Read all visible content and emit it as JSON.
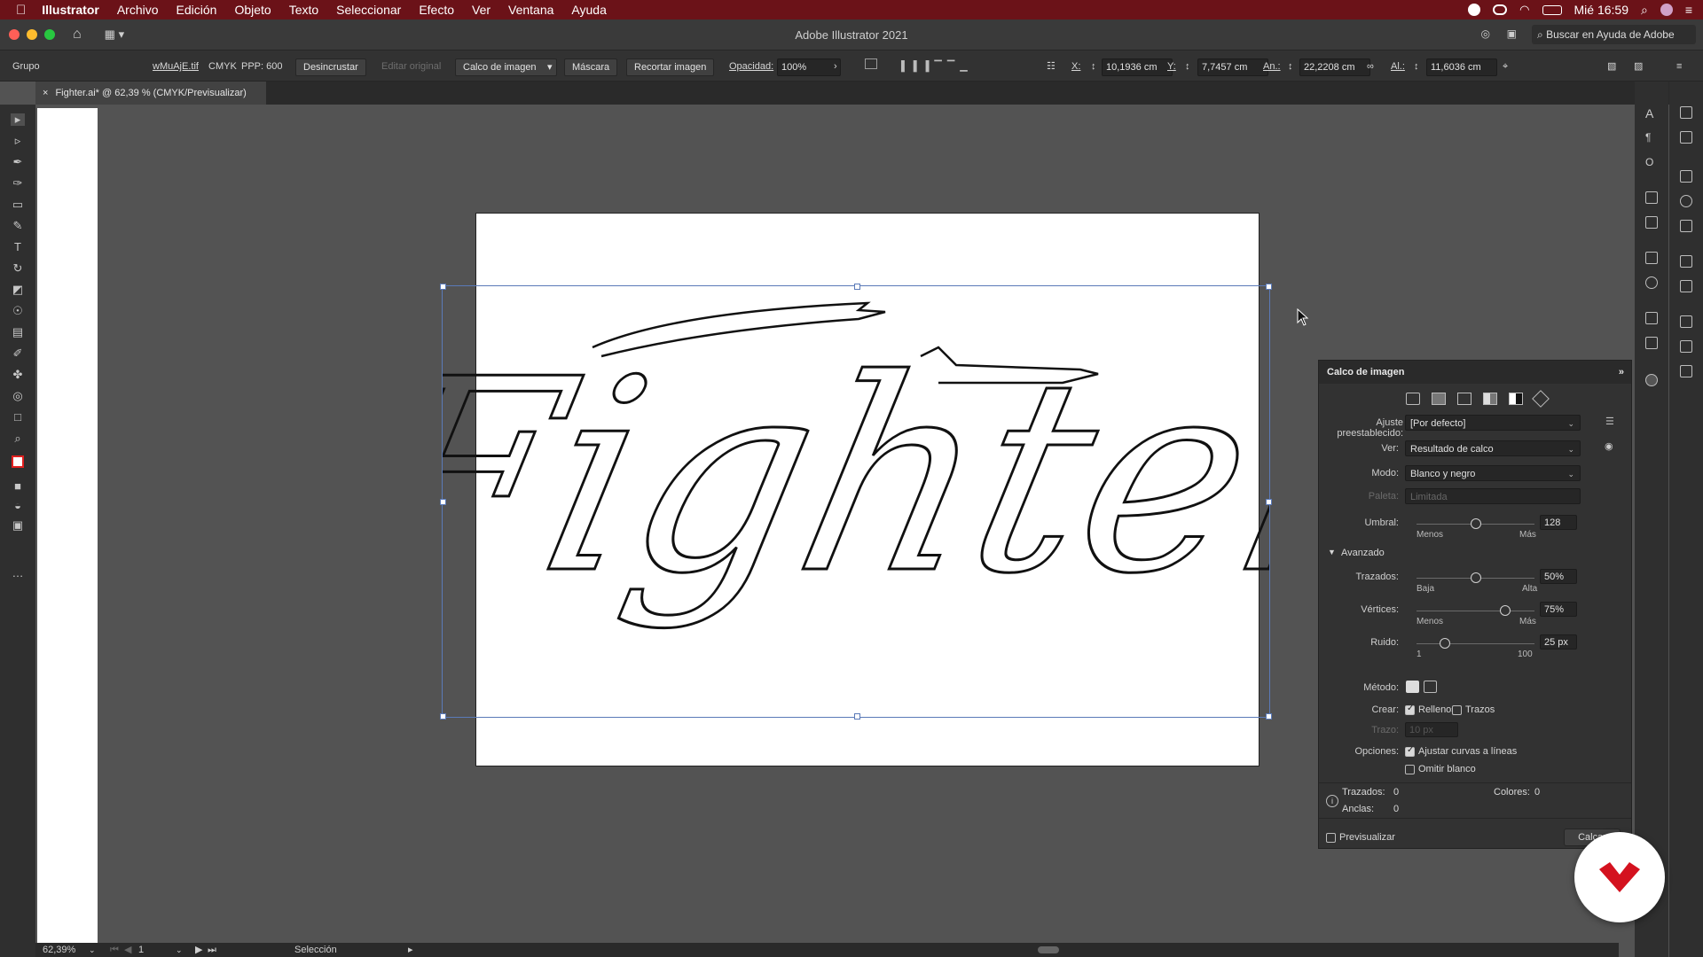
{
  "menubar": {
    "apple": "",
    "app": "Illustrator",
    "items": [
      "Archivo",
      "Edición",
      "Objeto",
      "Texto",
      "Seleccionar",
      "Efecto",
      "Ver",
      "Ventana",
      "Ayuda"
    ],
    "clock": "Mié 16:59"
  },
  "titlebar": {
    "title": "Adobe Illustrator 2021",
    "search": "Buscar en Ayuda de Adobe"
  },
  "control": {
    "group": "Grupo",
    "filename": "wMuAjE.tif",
    "colormode": "CMYK",
    "ppp": "PPP: 600",
    "desincrustar": "Desincrustar",
    "editar": "Editar original",
    "calco": "Calco de imagen",
    "mascara": "Máscara",
    "recortar": "Recortar imagen",
    "opacity_label": "Opacidad:",
    "opacity": "100%",
    "x_label": "X:",
    "x": "10,1936 cm",
    "y_label": "Y:",
    "y": "7,7457 cm",
    "w_label": "An.:",
    "w": "22,2208 cm",
    "h_label": "Al.:",
    "h": "11,6036 cm"
  },
  "tab": {
    "close": "×",
    "label": "Fighter.ai* @ 62,39 % (CMYK/Previsualizar)"
  },
  "artwork": {
    "text": "Fighter"
  },
  "panel": {
    "title": "Calco de imagen",
    "preset_label": "Ajuste preestablecido:",
    "preset": "[Por defecto]",
    "view_label": "Ver:",
    "view": "Resultado de calco",
    "mode_label": "Modo:",
    "mode": "Blanco y negro",
    "palette_label": "Paleta:",
    "palette": "Limitada",
    "threshold_label": "Umbral:",
    "threshold": "128",
    "threshold_value": 128,
    "less": "Menos",
    "more": "Más",
    "advanced": "Avanzado",
    "paths_label": "Trazados:",
    "paths": "50%",
    "paths_value": 50,
    "low": "Baja",
    "high": "Alta",
    "corners_label": "Vértices:",
    "corners": "75%",
    "corners_value": 75,
    "noise_label": "Ruido:",
    "noise": "25 px",
    "noise_value": 25,
    "noise_min": "1",
    "noise_max": "100",
    "method_label": "Método:",
    "create_label": "Crear:",
    "fills": "Rellenos",
    "strokes": "Trazos",
    "stroke_label": "Trazo:",
    "stroke": "10 px",
    "options_label": "Opciones:",
    "snap": "Ajustar curvas a líneas",
    "ignore_white": "Omitir blanco",
    "info_paths": "Trazados:",
    "info_paths_value": "0",
    "info_colors": "Colores:",
    "info_colors_value": "0",
    "info_anchors": "Anclas:",
    "info_anchors_value": "0",
    "preview": "Previsualizar",
    "trace_button": "Calcar"
  },
  "status": {
    "zoom": "62,39%",
    "page": "1",
    "tool": "Selección"
  },
  "colors": {
    "menubar": "#6b1218",
    "badge": "#d4121f"
  }
}
